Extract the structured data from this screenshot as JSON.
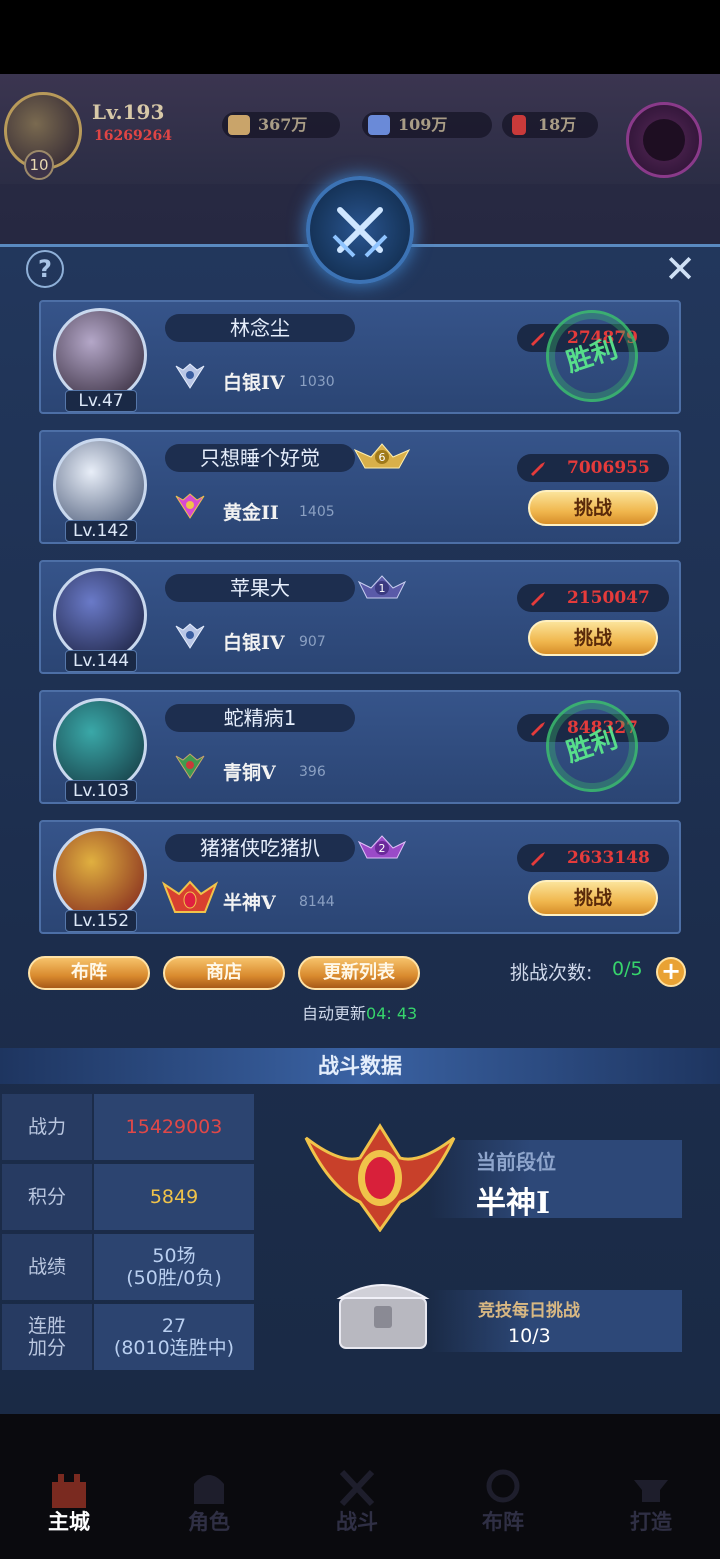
{
  "player": {
    "level": "Lv.193",
    "power": "16269264",
    "vip": "10"
  },
  "resources": [
    {
      "name": "gold-icon",
      "value": "367万",
      "color": "#c9a46a"
    },
    {
      "name": "diamond-icon",
      "value": "109万",
      "color": "#6a8ad8"
    },
    {
      "name": "ruby-icon",
      "value": "18万",
      "color": "#c93a3a"
    }
  ],
  "opponents": [
    {
      "name": "林念尘",
      "level": "Lv.47",
      "tier": "白银IV",
      "points": "1030",
      "power": "274879",
      "status": "victory",
      "tier_color": "#b9c6e6"
    },
    {
      "name": "只想睡个好觉",
      "level": "Lv.142",
      "tier": "黄金II",
      "points": "1405",
      "power": "7006955",
      "status": "challenge",
      "tier_color": "#d84ad2",
      "rank_badge": "6"
    },
    {
      "name": "苹果大",
      "level": "Lv.144",
      "tier": "白银IV",
      "points": "907",
      "power": "2150047",
      "status": "challenge",
      "tier_color": "#b9c6e6",
      "rank_badge": "1"
    },
    {
      "name": "蛇精病1",
      "level": "Lv.103",
      "tier": "青铜V",
      "points": "396",
      "power": "848327",
      "status": "victory",
      "tier_color": "#3f9a50"
    },
    {
      "name": "猪猪侠吃猪扒",
      "level": "Lv.152",
      "tier": "半神V",
      "points": "8144",
      "power": "2633148",
      "status": "challenge",
      "tier_color": "#d8402f",
      "rank_badge": "2"
    }
  ],
  "labels": {
    "challenge": "挑战",
    "victory": "胜利",
    "formation": "布阵",
    "shop": "商店",
    "refresh": "更新列表",
    "tries_label": "挑战次数:",
    "tries_value": "0/5",
    "auto_refresh": "自动更新",
    "auto_refresh_time": "04: 43",
    "help": "?",
    "close": "✕",
    "plus": "+"
  },
  "stats": {
    "title": "战斗数据",
    "rows": [
      {
        "key": "战力",
        "value": "15429003",
        "value2": "",
        "color": "#e04848"
      },
      {
        "key": "积分",
        "value": "5849",
        "value2": "",
        "color": "#f0c34a"
      },
      {
        "key": "战绩",
        "value": "50场",
        "value2": "(50胜/0负)",
        "color": "#9fc0ee"
      },
      {
        "key": "连胜\n加分",
        "value": "27",
        "value2": "(8010连胜中)",
        "color": "#9fc0ee"
      }
    ],
    "rank_label": "当前段位",
    "rank_value": "半神I",
    "daily_label": "竞技每日挑战",
    "daily_value": "10/3"
  },
  "nav": [
    {
      "label": "主城",
      "active": true
    },
    {
      "label": "角色",
      "active": false
    },
    {
      "label": "战斗",
      "active": false
    },
    {
      "label": "布阵",
      "active": false
    },
    {
      "label": "打造",
      "active": false
    }
  ]
}
